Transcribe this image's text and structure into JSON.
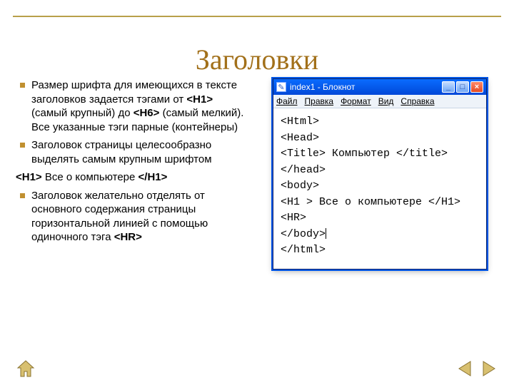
{
  "title": "Заголовки",
  "bullets": {
    "b1_pre": "Размер шрифта для имеющихся в тексте заголовков задается тэгами от ",
    "b1_tag1": "<H1>",
    "b1_mid": " (самый крупный) до ",
    "b1_tag2": "<H6>",
    "b1_post": " (самый мелкий). Все указанные тэги парные (контейнеры)",
    "b2": "Заголовок страницы целесообразно выделять самым крупным шрифтом",
    "ex_open": "<H1>",
    "ex_text": " Все о компьютере ",
    "ex_close": "</H1>",
    "b3_pre": "Заголовок желательно отделять от основного содержания страницы горизонтальной линией с помощью одиночного тэга ",
    "b3_tag": "<HR>"
  },
  "notepad": {
    "title": "index1 - Блокнот",
    "menu": {
      "file": "Файл",
      "edit": "Правка",
      "format": "Формат",
      "view": "Вид",
      "help": "Справка"
    },
    "lines": {
      "l1": "<Html>",
      "l2": "  <Head>",
      "l3": "    <Title> Компьютер </title>",
      "l4": "   </head>",
      "l5": "  <body>",
      "l6": " <H1 > Все о компьютере </H1>",
      "l7": " <HR>",
      "l8": "   </body>",
      "l9": "</html>"
    }
  }
}
